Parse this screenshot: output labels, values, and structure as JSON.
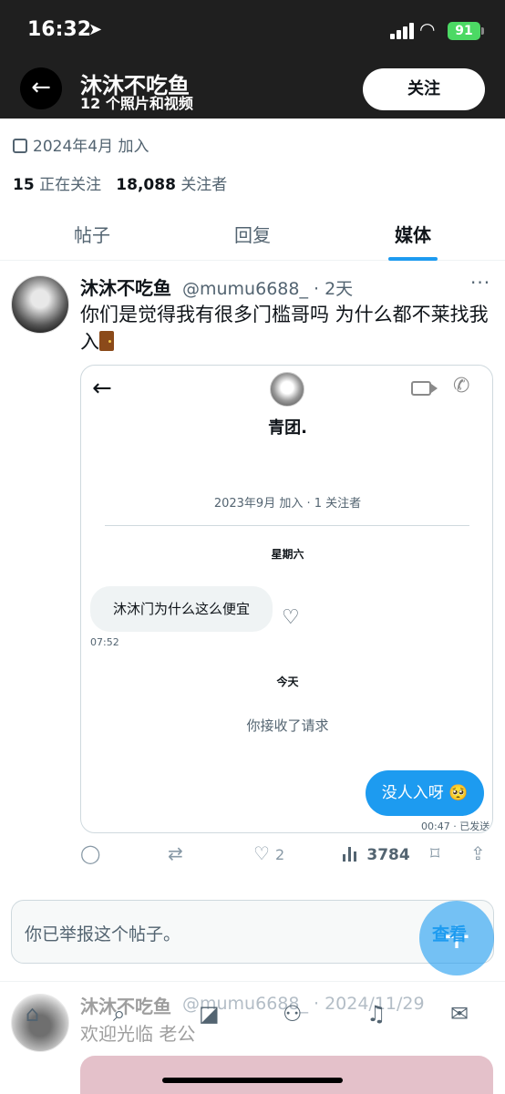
{
  "status_bar": {
    "time": "16:32",
    "battery": "91"
  },
  "header": {
    "name": "沐沐不吃鱼",
    "subtitle": "12 个照片和视频",
    "follow_label": "关注"
  },
  "profile": {
    "joined": "2024年4月 加入",
    "following_count": "15",
    "following_label": "正在关注",
    "followers_count": "18,088",
    "followers_label": "关注者"
  },
  "tabs": [
    {
      "label": "帖子"
    },
    {
      "label": "回复"
    },
    {
      "label": "媒体"
    }
  ],
  "post": {
    "author": "沐沐不吃鱼",
    "handle_time": "@mumu6688_ · 2天",
    "more": "···",
    "text": "你们是觉得我有很多门槛哥吗 为什么都不莱找我入",
    "embed": {
      "title": "青团.",
      "joined_info": "2023年9月 加入 · 1 关注者",
      "day_label": "星期六",
      "incoming_message": "沐沐门为什么这么便宜",
      "incoming_time": "07:52",
      "today_label": "今天",
      "accepted_text": "你接收了请求",
      "outgoing_message": "没人入呀 🥺",
      "outgoing_status": "00:47 · 已发送"
    },
    "likes": "2",
    "views": "3784"
  },
  "reported": {
    "text": "你已举报这个帖子。",
    "view_label": "查看"
  },
  "post2": {
    "author": "沐沐不吃鱼",
    "handle_time": "@mumu6688_ · 2024/11/29",
    "text": "欢迎光临 老公"
  },
  "accent_color": "#1d9bf0"
}
